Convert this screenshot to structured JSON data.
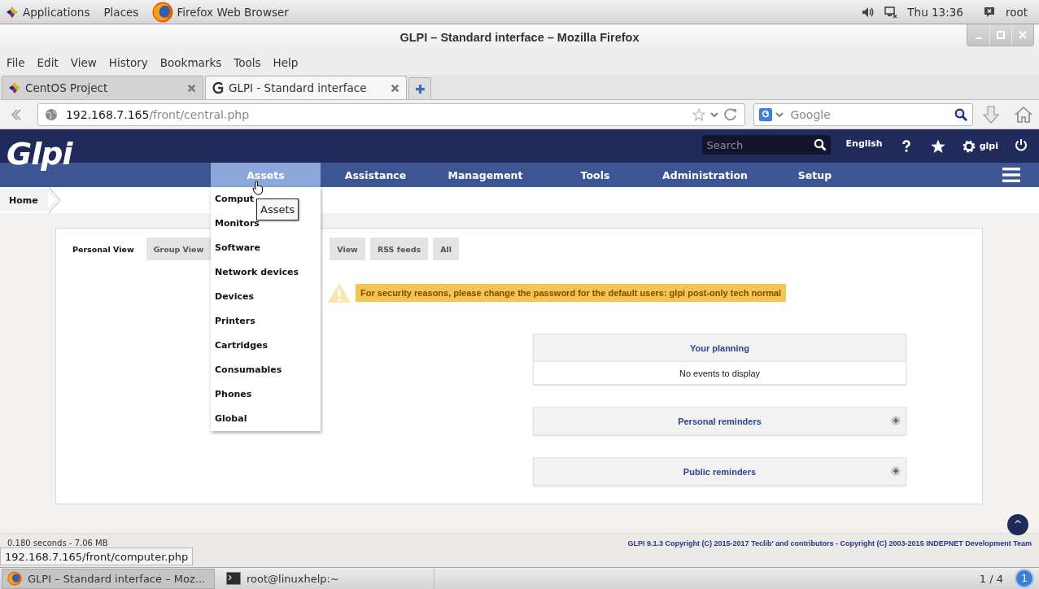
{
  "desktop_bar": {
    "menus": [
      "Applications",
      "Places"
    ],
    "app": "Firefox Web Browser",
    "clock": "Thu 13:36",
    "user": "root"
  },
  "window": {
    "title": "GLPI – Standard interface – Mozilla Firefox"
  },
  "menu_bar": [
    "File",
    "Edit",
    "View",
    "History",
    "Bookmarks",
    "Tools",
    "Help"
  ],
  "browser_tabs": [
    {
      "label": "CentOS Project",
      "selected": false
    },
    {
      "label": "GLPI - Standard interface",
      "selected": true
    }
  ],
  "address_bar": {
    "host": "192.168.7.165",
    "path": "/front/central.php"
  },
  "web_search": {
    "placeholder": "Google"
  },
  "glpi": {
    "logo": "Glpi",
    "search": {
      "placeholder": "Search"
    },
    "language": "English",
    "user": "glpi",
    "menu": [
      {
        "label": "Assets",
        "selected": true
      },
      {
        "label": "Assistance",
        "selected": false
      },
      {
        "label": "Management",
        "selected": false
      },
      {
        "label": "Tools",
        "selected": false
      },
      {
        "label": "Administration",
        "selected": false
      },
      {
        "label": "Setup",
        "selected": false
      }
    ],
    "assets_menu": [
      "Comput",
      "Monitors",
      "Software",
      "Network devices",
      "Devices",
      "Printers",
      "Cartridges",
      "Consumables",
      "Phones",
      "Global"
    ],
    "tooltip": "Assets",
    "breadcrumb": "Home",
    "view_tabs": [
      {
        "label": "Personal View",
        "selected": true
      },
      {
        "label": "Group View",
        "selected": false
      },
      {
        "label": "View",
        "selected": false
      },
      {
        "label": "RSS feeds",
        "selected": false
      },
      {
        "label": "All",
        "selected": false
      }
    ],
    "warning": "For security reasons, please change the password for the default users: glpi post-only tech normal",
    "panels": [
      {
        "title": "Your planning",
        "expanded": true,
        "body": "No events to display"
      },
      {
        "title": "Personal reminders",
        "expanded": false
      },
      {
        "title": "Public reminders",
        "expanded": false
      }
    ],
    "footer": {
      "timing": "0.180 seconds - 7.06 MB",
      "copyright": "GLPI 9.1.3 Copyright (C) 2015-2017 Teclib' and contributors - Copyright (C) 2003-2015 INDEPNET Development Team"
    },
    "scroll_top": "^"
  },
  "status_link": "192.168.7.165/front/computer.php",
  "taskbar": {
    "items": [
      {
        "label": "GLPI – Standard interface – Moz...",
        "selected": true
      },
      {
        "label": "root@linuxhelp:~",
        "selected": false
      }
    ],
    "workspace": "1 / 4",
    "notifications": "1"
  }
}
